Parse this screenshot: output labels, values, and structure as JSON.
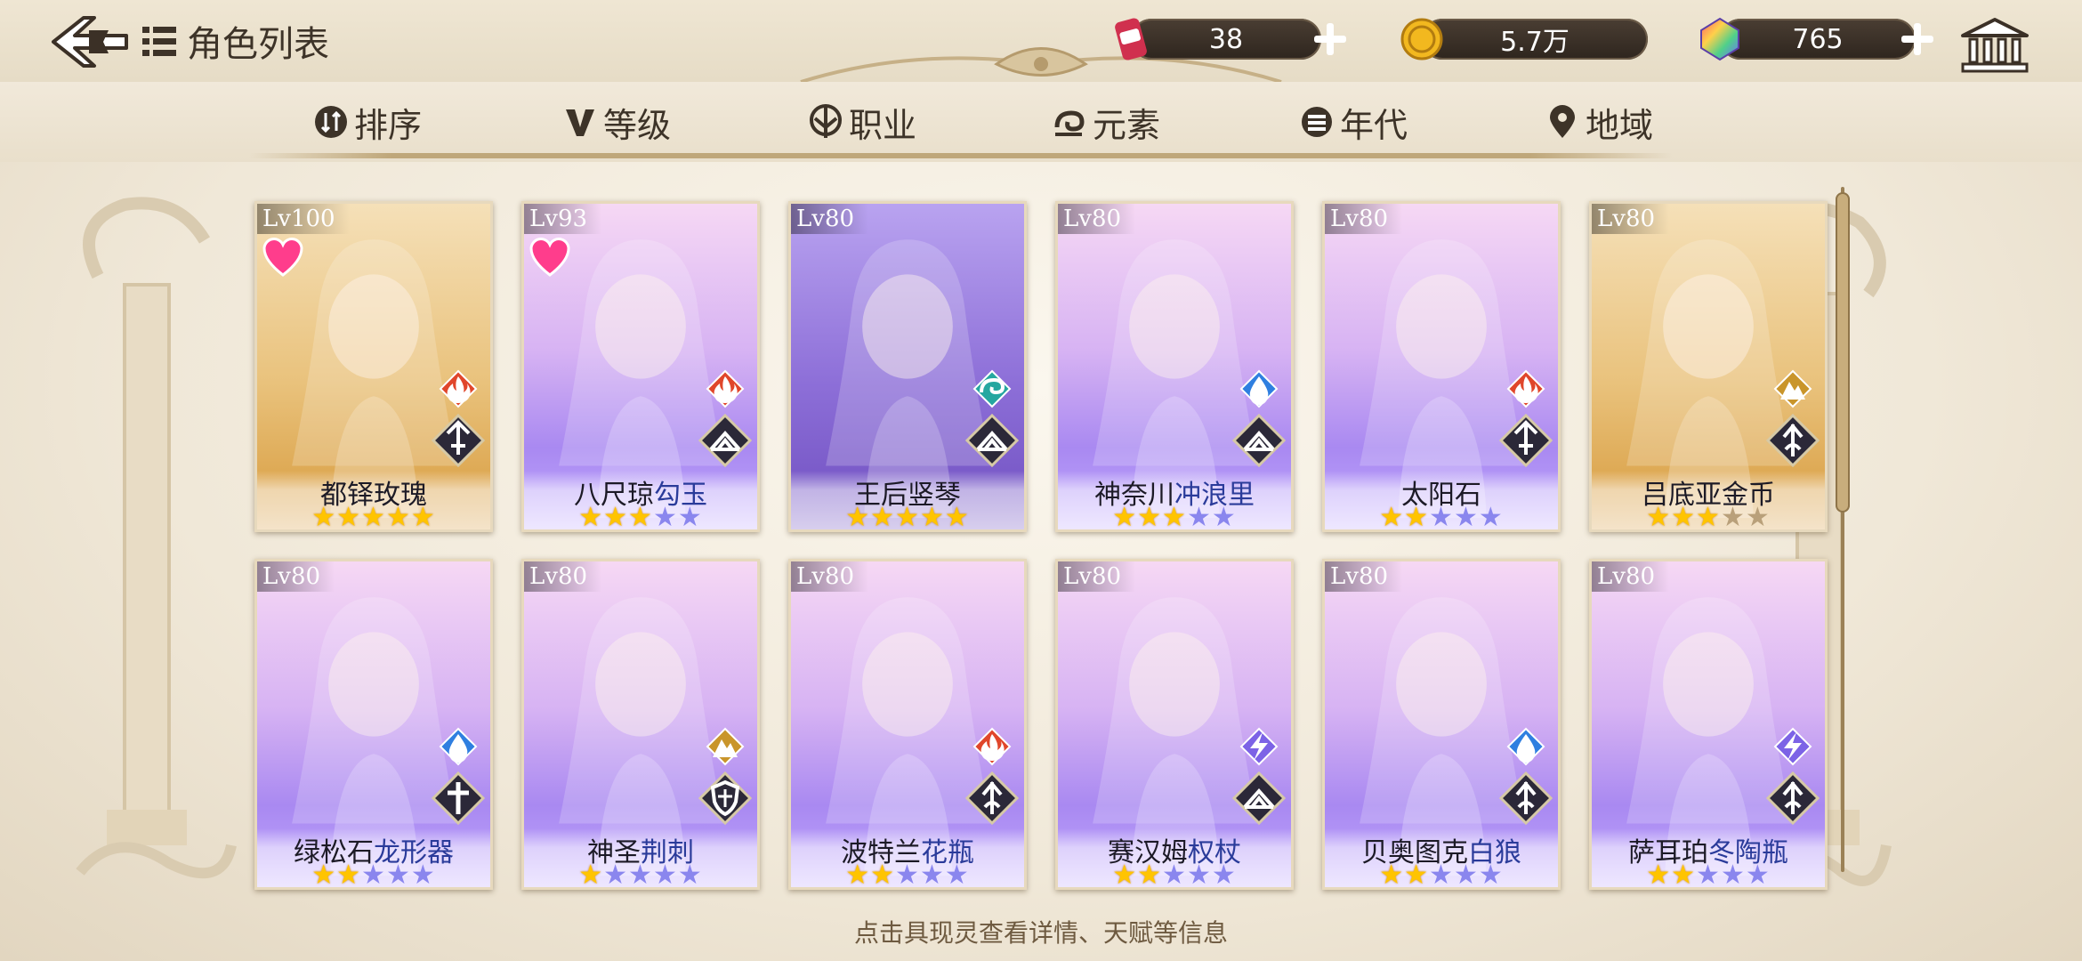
{
  "header": {
    "title": "角色列表",
    "resources": [
      {
        "icon": "stamina-can-icon",
        "value": "38"
      },
      {
        "icon": "gold-coin-icon",
        "value": "5.7万"
      },
      {
        "icon": "rainbow-gem-icon",
        "value": "765"
      }
    ]
  },
  "tabs": [
    {
      "label": "排序",
      "icon": "sort-icon"
    },
    {
      "label": "等级",
      "icon": "level-v-icon"
    },
    {
      "label": "职业",
      "icon": "class-icon"
    },
    {
      "label": "元素",
      "icon": "element-icon"
    },
    {
      "label": "年代",
      "icon": "era-icon"
    },
    {
      "label": "地域",
      "icon": "location-pin-icon"
    }
  ],
  "cards": [
    {
      "lv": "Lv100",
      "name_a": "都铎玫瑰",
      "name_b": "",
      "stars": 5,
      "max": 5,
      "heart": true,
      "element": "fire",
      "class": "sword",
      "bg": "gold"
    },
    {
      "lv": "Lv93",
      "name_a": "八尺琼",
      "name_b": "勾玉",
      "stars": 3,
      "max": 5,
      "heart": true,
      "element": "fire",
      "class": "book",
      "bg": "purple"
    },
    {
      "lv": "Lv80",
      "name_a": "王后竖琴",
      "name_b": "",
      "stars": 5,
      "max": 5,
      "heart": false,
      "element": "wind",
      "class": "book",
      "bg": "violet"
    },
    {
      "lv": "Lv80",
      "name_a": "神奈川",
      "name_b": "冲浪里",
      "stars": 3,
      "max": 5,
      "heart": false,
      "element": "water",
      "class": "book",
      "bg": "purple"
    },
    {
      "lv": "Lv80",
      "name_a": "太阳石",
      "name_b": "",
      "stars": 2,
      "max": 5,
      "heart": false,
      "element": "fire",
      "class": "sword",
      "bg": "purple"
    },
    {
      "lv": "Lv80",
      "name_a": "吕底亚金币",
      "name_b": "",
      "stars": 3,
      "max": 5,
      "heart": false,
      "element": "earth",
      "class": "spear",
      "bg": "gold"
    },
    {
      "lv": "Lv80",
      "name_a": "绿松石",
      "name_b": "龙形器",
      "stars": 2,
      "max": 5,
      "heart": false,
      "element": "water",
      "class": "cross",
      "bg": "purple"
    },
    {
      "lv": "Lv80",
      "name_a": "神圣",
      "name_b": "荆刺",
      "stars": 1,
      "max": 5,
      "heart": false,
      "element": "earth",
      "class": "shield",
      "bg": "purple"
    },
    {
      "lv": "Lv80",
      "name_a": "波特兰",
      "name_b": "花瓶",
      "stars": 2,
      "max": 5,
      "heart": false,
      "element": "fire",
      "class": "spear",
      "bg": "purple"
    },
    {
      "lv": "Lv80",
      "name_a": "赛汉姆",
      "name_b": "权杖",
      "stars": 2,
      "max": 5,
      "heart": false,
      "element": "thunder",
      "class": "book",
      "bg": "purple"
    },
    {
      "lv": "Lv80",
      "name_a": "贝奥图克",
      "name_b": "白狼",
      "stars": 2,
      "max": 5,
      "heart": false,
      "element": "water",
      "class": "spear",
      "bg": "purple"
    },
    {
      "lv": "Lv80",
      "name_a": "萨耳珀",
      "name_b": "冬陶瓶",
      "stars": 2,
      "max": 5,
      "heart": false,
      "element": "thunder",
      "class": "spear",
      "bg": "purple"
    }
  ],
  "hint": "点击具现灵查看详情、天赋等信息"
}
